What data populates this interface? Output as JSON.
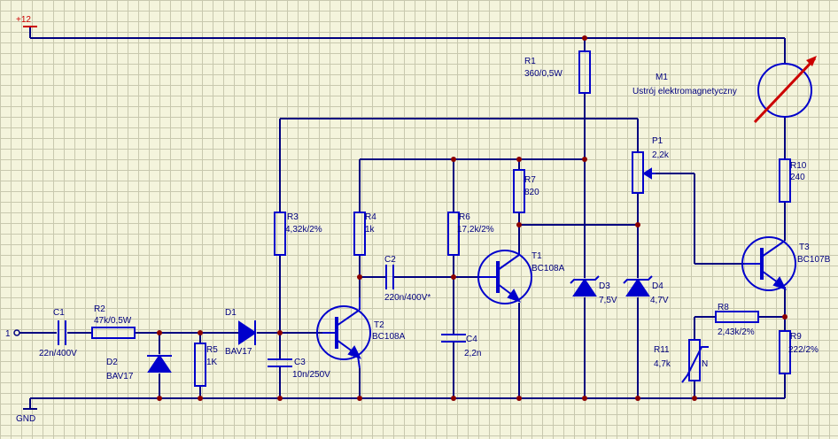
{
  "supply": {
    "label": "+12"
  },
  "ground": {
    "label": "GND"
  },
  "input": {
    "label": "1"
  },
  "components": {
    "C1": {
      "ref": "C1",
      "value": "22n/400V"
    },
    "R2": {
      "ref": "R2",
      "value": "47k/0,5W"
    },
    "D2": {
      "ref": "D2",
      "value": "BAV17"
    },
    "R5": {
      "ref": "R5",
      "value": "1K"
    },
    "D1": {
      "ref": "D1",
      "value": "BAV17"
    },
    "R3": {
      "ref": "R3",
      "value": "4,32k/2%"
    },
    "C3": {
      "ref": "C3",
      "value": "10n/250V"
    },
    "R4": {
      "ref": "R4",
      "value": "1k"
    },
    "T2": {
      "ref": "T2",
      "value": "BC108A"
    },
    "C2": {
      "ref": "C2",
      "value": "220n/400V*"
    },
    "R6": {
      "ref": "R6",
      "value": "17,2k/2%"
    },
    "C4": {
      "ref": "C4",
      "value": "2,2n"
    },
    "R7": {
      "ref": "R7",
      "value": "820"
    },
    "T1": {
      "ref": "T1",
      "value": "BC108A"
    },
    "R1": {
      "ref": "R1",
      "value": "360/0,5W"
    },
    "D3": {
      "ref": "D3",
      "value": "7,5V"
    },
    "D4": {
      "ref": "D4",
      "value": "4,7V"
    },
    "P1": {
      "ref": "P1",
      "value": "2,2k"
    },
    "M1": {
      "ref": "M1",
      "value": "Ustrój elektromagnetyczny"
    },
    "R10": {
      "ref": "R10",
      "value": "240"
    },
    "T3": {
      "ref": "T3",
      "value": "BC107B"
    },
    "R8": {
      "ref": "R8",
      "value": "2,43k/2%"
    },
    "R11": {
      "ref": "R11",
      "value": "4,7k"
    },
    "R11_mark": "N",
    "R9": {
      "ref": "R9",
      "value": "222/2%"
    }
  }
}
